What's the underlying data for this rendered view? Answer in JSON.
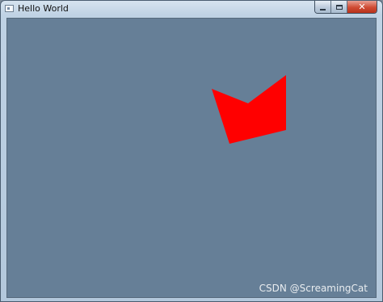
{
  "window": {
    "title": "Hello World",
    "icons": {
      "app": "app-window-icon",
      "minimize": "minimize-icon",
      "maximize": "maximize-icon",
      "close": "close-icon"
    },
    "close_glyph": "✕"
  },
  "canvas": {
    "background_color": "#667f97",
    "shape": {
      "kind": "concave polygon",
      "fill_color": "#ff0000"
    }
  },
  "watermark": "CSDN @ScreamingCat"
}
